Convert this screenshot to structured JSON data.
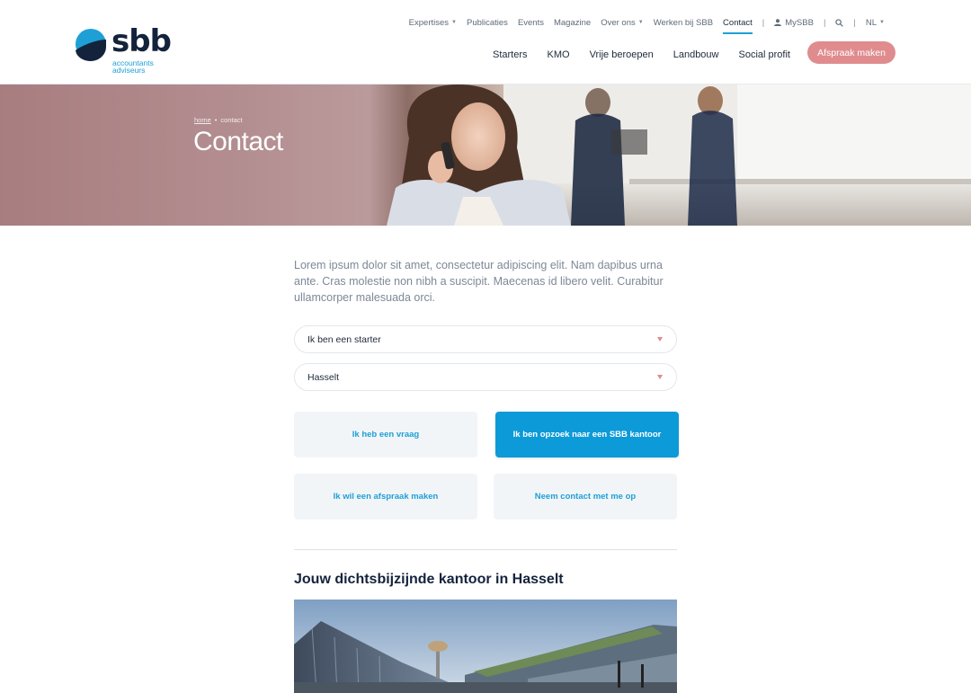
{
  "brand": {
    "name": "sbb",
    "sub_line1": "accountants",
    "sub_line2": "adviseurs",
    "primary_color": "#1ea0d6",
    "dark_color": "#14233c"
  },
  "top_nav": {
    "items": [
      {
        "label": "Expertises",
        "dropdown": true
      },
      {
        "label": "Publicaties",
        "dropdown": false
      },
      {
        "label": "Events",
        "dropdown": false
      },
      {
        "label": "Magazine",
        "dropdown": false
      },
      {
        "label": "Over ons",
        "dropdown": true
      },
      {
        "label": "Werken bij SBB",
        "dropdown": false
      },
      {
        "label": "Contact",
        "dropdown": false,
        "active": true
      }
    ],
    "separator": "|",
    "account_label": "MySBB",
    "language": "NL"
  },
  "main_nav": {
    "items": [
      "Starters",
      "KMO",
      "Vrije beroepen",
      "Landbouw",
      "Social profit"
    ],
    "cta_label": "Afspraak maken",
    "cta_color": "#e08c8f"
  },
  "hero": {
    "breadcrumb_home": "home",
    "breadcrumb_sep": "•",
    "breadcrumb_current": "contact",
    "title": "Contact"
  },
  "intro_text": "Lorem ipsum dolor sit amet, consectetur adipiscing elit. Nam dapibus urna ante. Cras molestie non nibh a suscipit. Maecenas id libero velit. Curabitur ullamcorper malesuada orci.",
  "form": {
    "profile_select": "Ik ben een starter",
    "location_select": "Hasselt"
  },
  "choices": [
    {
      "label": "Ik heb een vraag",
      "active": false
    },
    {
      "label": "Ik ben opzoek naar een SBB kantoor",
      "active": true
    },
    {
      "label": "Ik wil een afspraak maken",
      "active": false
    },
    {
      "label": "Neem contact met me op",
      "active": false
    }
  ],
  "office": {
    "heading": "Jouw dichtsbijzijnde kantoor in Hasselt"
  }
}
